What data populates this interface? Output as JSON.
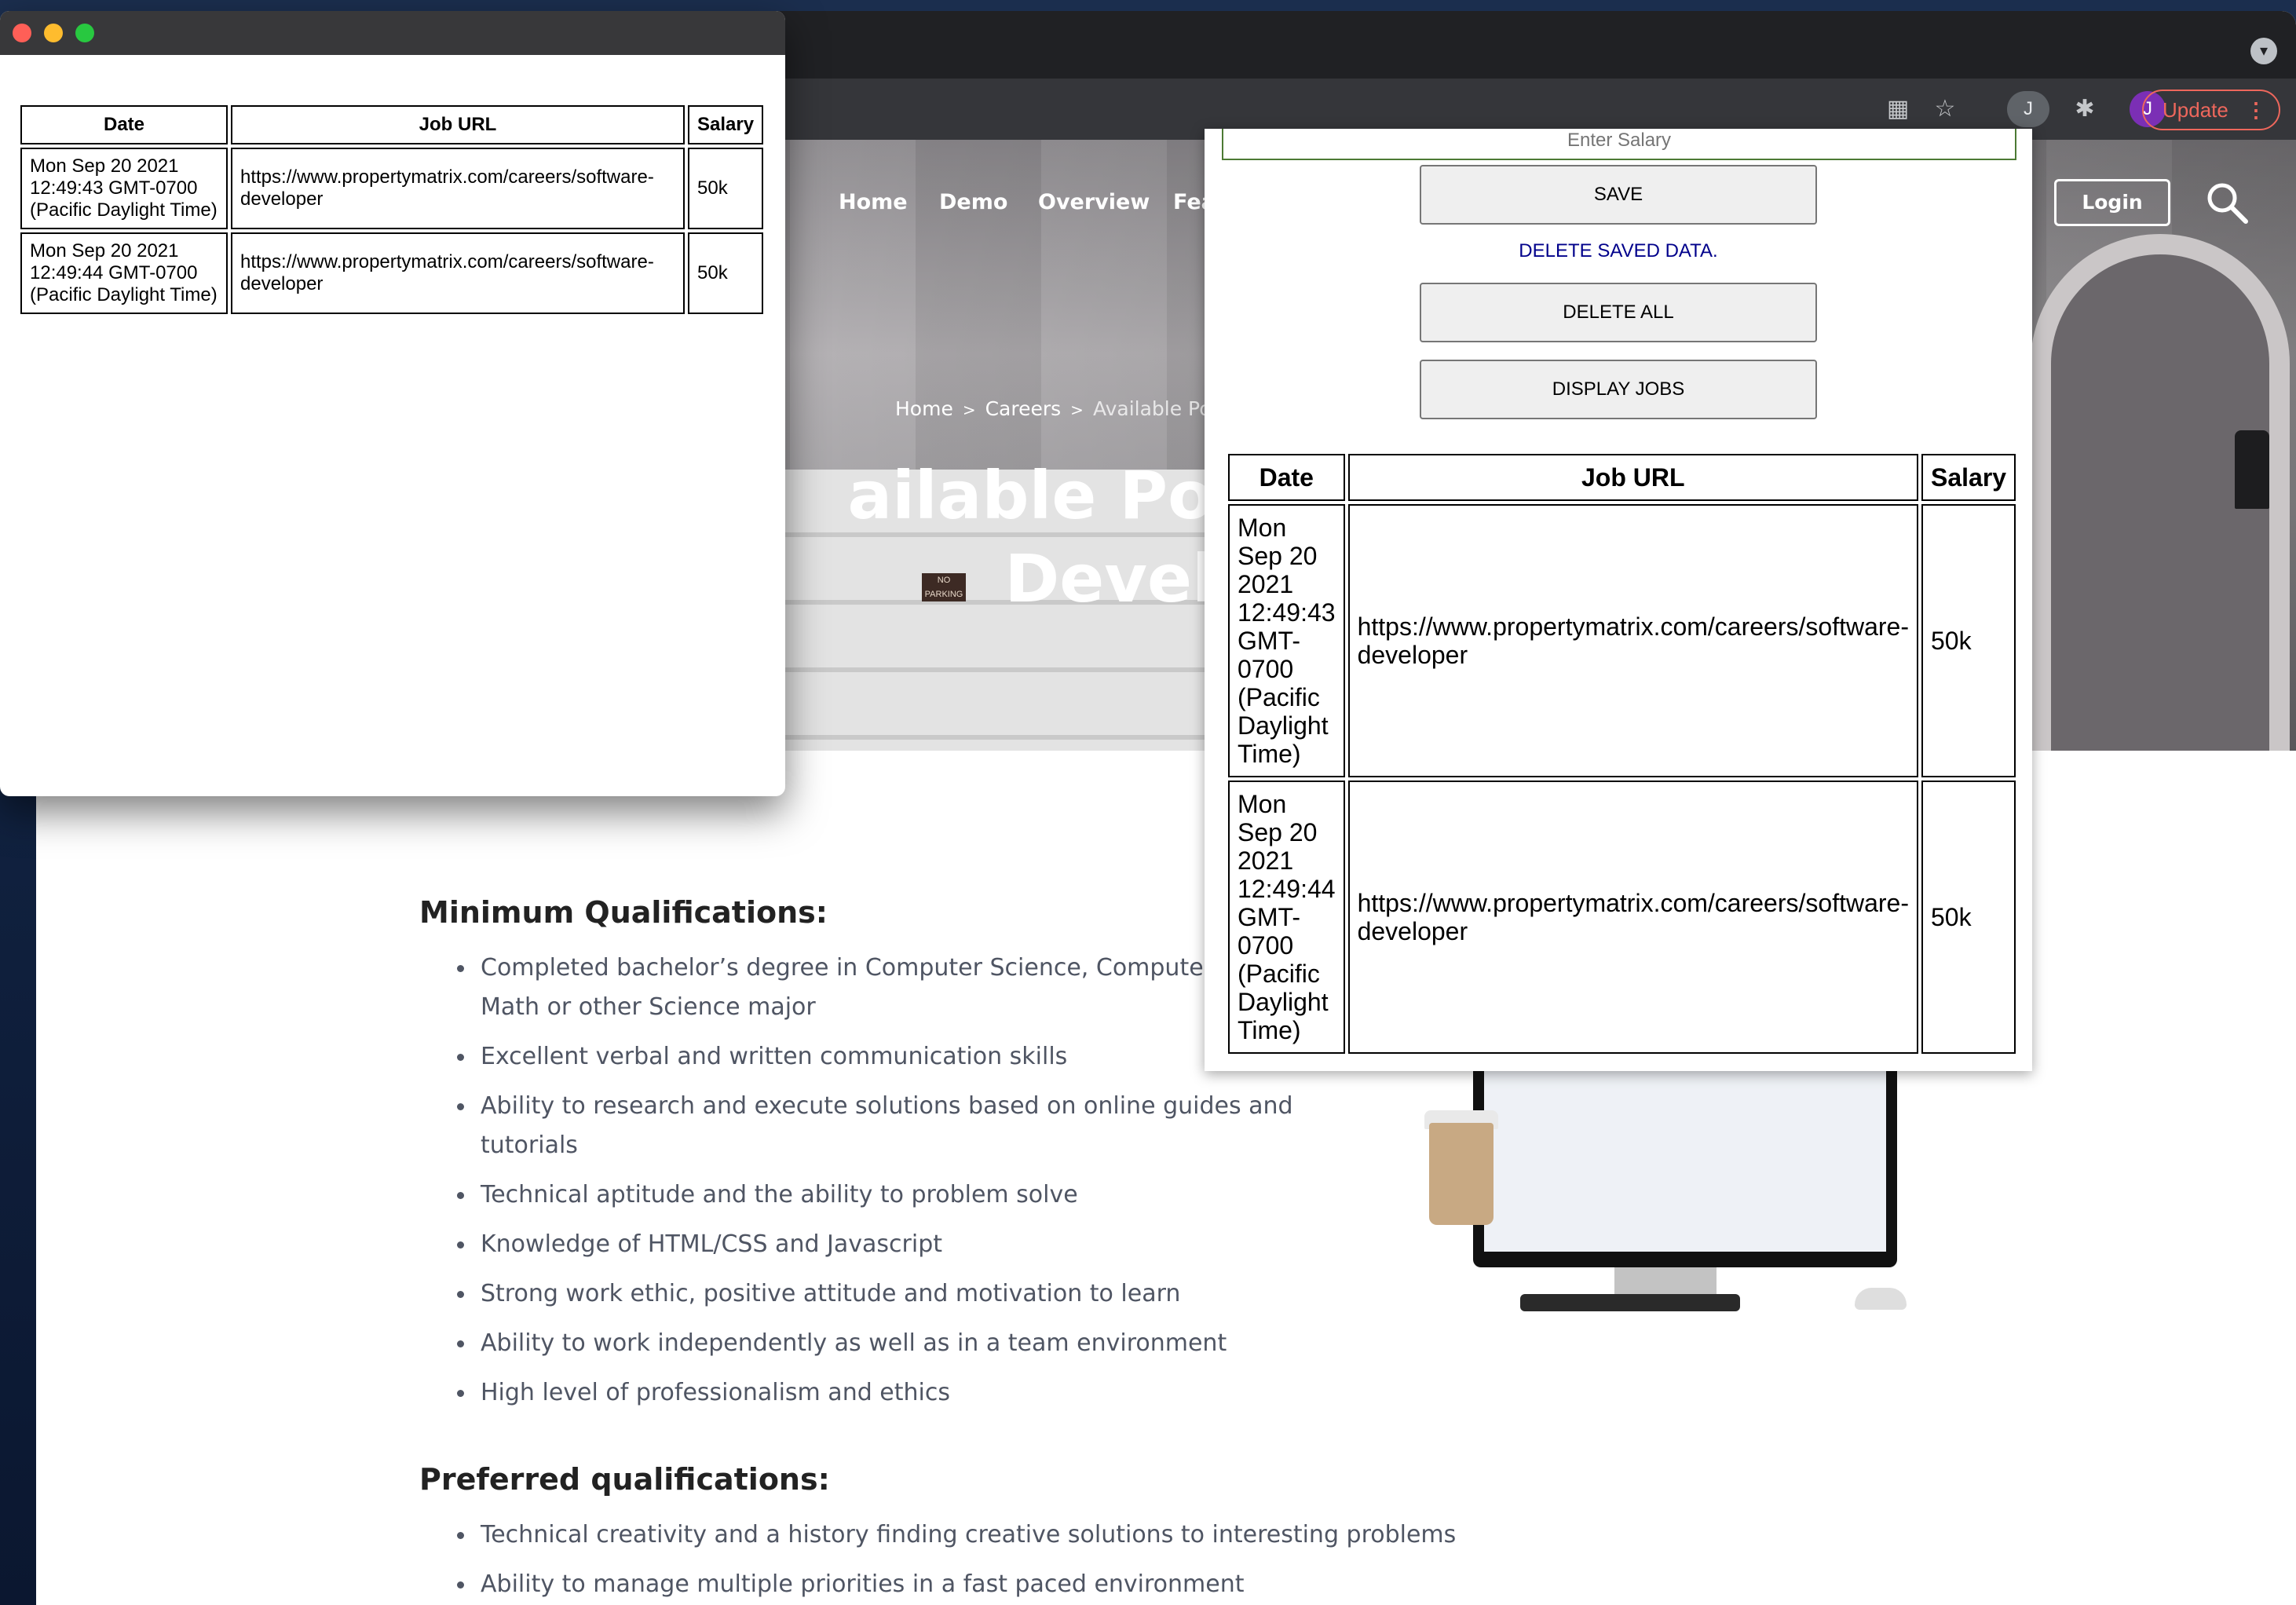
{
  "browser": {
    "update_label": "Update",
    "extension_label": "J",
    "profile_initial": "J"
  },
  "site": {
    "nav": [
      "Home",
      "Demo",
      "Overview",
      "Fea"
    ],
    "login_label": "Login",
    "breadcrumb": [
      "Home",
      "Careers",
      "Available Posit"
    ],
    "hero_title_line1": "ailable Positi",
    "hero_title_line2": "Develo",
    "sign_text": "NO PARKING",
    "min_heading": "Minimum Qualifications:",
    "min_items": [
      "Completed bachelor’s degree in Computer Science, Computer E",
      "Math or other Science major",
      "Excellent verbal and written communication skills",
      "Ability to research and execute solutions based on online guides and",
      "tutorials",
      "Technical aptitude and the ability to problem solve",
      "Knowledge of HTML/CSS and Javascript",
      "Strong work ethic, positive attitude and motivation to learn",
      "Ability to work independently as well as in a team environment",
      "High level of professionalism and ethics"
    ],
    "pref_heading": "Preferred qualifications:",
    "pref_items": [
      "Technical creativity and a history finding creative solutions to interesting problems",
      "Ability to manage multiple priorities in a fast paced environment"
    ]
  },
  "popup": {
    "salary_placeholder": "Enter Salary",
    "save_label": "SAVE",
    "delete_saved_label": "DELETE SAVED DATA.",
    "delete_all_label": "DELETE ALL",
    "display_jobs_label": "DISPLAY JOBS",
    "table": {
      "headers": [
        "Date",
        "Job URL",
        "Salary"
      ],
      "rows": [
        [
          "Mon Sep 20 2021 12:49:43 GMT-0700 (Pacific Daylight Time)",
          "https://www.propertymatrix.com/careers/software-developer",
          "50k"
        ],
        [
          "Mon Sep 20 2021 12:49:44 GMT-0700 (Pacific Daylight Time)",
          "https://www.propertymatrix.com/careers/software-developer",
          "50k"
        ]
      ]
    }
  },
  "mini_window": {
    "table": {
      "headers": [
        "Date",
        "Job URL",
        "Salary"
      ],
      "rows": [
        [
          "Mon Sep 20 2021 12:49:43 GMT-0700 (Pacific Daylight Time)",
          "https://www.propertymatrix.com/careers/software-developer",
          "50k"
        ],
        [
          "Mon Sep 20 2021 12:49:44 GMT-0700 (Pacific Daylight Time)",
          "https://www.propertymatrix.com/careers/software-developer",
          "50k"
        ]
      ]
    }
  },
  "colors": {
    "close": "#ff5f57",
    "minimize": "#febc2e",
    "zoom": "#28c840",
    "update_accent": "#ee675c",
    "link_blue": "#00008b"
  }
}
